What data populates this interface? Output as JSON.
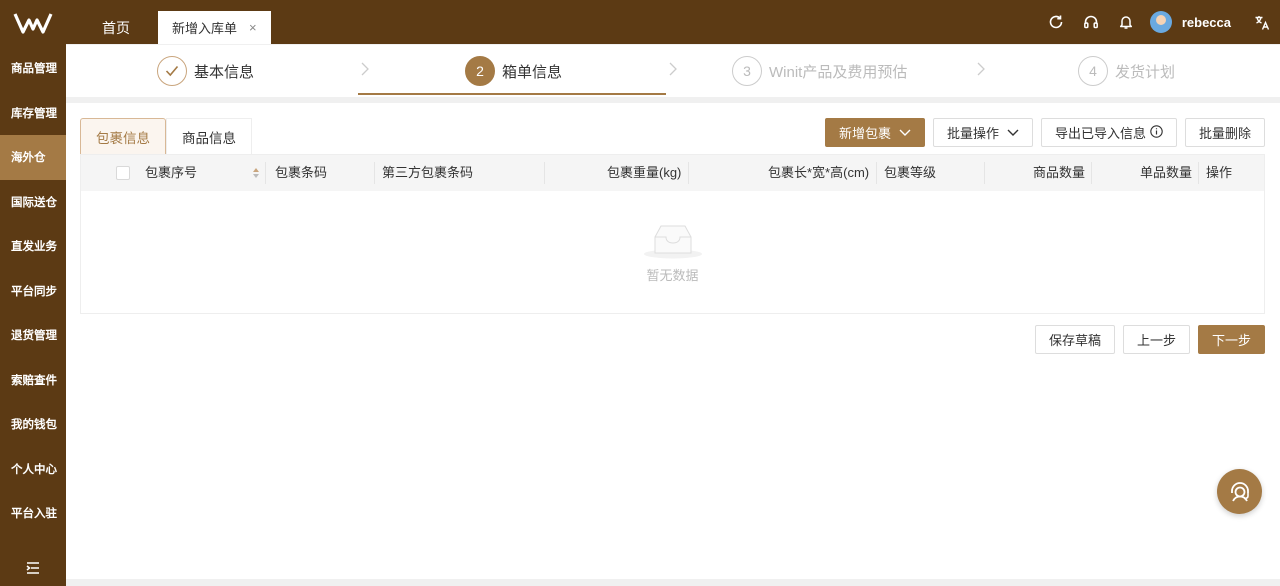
{
  "colors": {
    "brand_dark": "#5c3a14",
    "accent": "#a47a45"
  },
  "sidebar": {
    "logo_icon": "winit-logo",
    "items": [
      {
        "label": "商品管理",
        "active": false
      },
      {
        "label": "库存管理",
        "active": false
      },
      {
        "label": "海外仓",
        "active": true
      },
      {
        "label": "国际送仓",
        "active": false
      },
      {
        "label": "直发业务",
        "active": false
      },
      {
        "label": "平台同步",
        "active": false
      },
      {
        "label": "退货管理",
        "active": false
      },
      {
        "label": "索赔查件",
        "active": false
      },
      {
        "label": "我的钱包",
        "active": false
      },
      {
        "label": "个人中心",
        "active": false
      },
      {
        "label": "平台入驻",
        "active": false
      }
    ],
    "collapse_icon": "menu-collapse-icon"
  },
  "topbar": {
    "tabs": [
      {
        "label": "首页"
      },
      {
        "label": "新增入库单",
        "close": "×"
      }
    ],
    "icons": [
      "refresh-icon",
      "headset-icon",
      "bell-icon",
      "translate-icon"
    ],
    "username": "rebecca"
  },
  "steps": [
    {
      "number": "",
      "label": "基本信息",
      "state": "done"
    },
    {
      "number": "2",
      "label": "箱单信息",
      "state": "current"
    },
    {
      "number": "3",
      "label": "Winit产品及费用预估",
      "state": "pending"
    },
    {
      "number": "4",
      "label": "发货计划",
      "state": "pending"
    }
  ],
  "main": {
    "subtabs": [
      {
        "label": "包裹信息",
        "active": true
      },
      {
        "label": "商品信息",
        "active": false
      }
    ],
    "actions": {
      "add_package": "新增包裹",
      "batch_ops": "批量操作",
      "export": "导出已导入信息",
      "batch_delete": "批量删除"
    },
    "table": {
      "columns": [
        "包裹序号",
        "包裹条码",
        "第三方包裹条码",
        "包裹重量(kg)",
        "包裹长*宽*高(cm)",
        "包裹等级",
        "商品数量",
        "单品数量",
        "操作"
      ],
      "rows": [],
      "empty_text": "暂无数据"
    },
    "footer": {
      "save_draft": "保存草稿",
      "prev": "上一步",
      "next": "下一步"
    }
  },
  "fab_icon": "customer-service-icon"
}
